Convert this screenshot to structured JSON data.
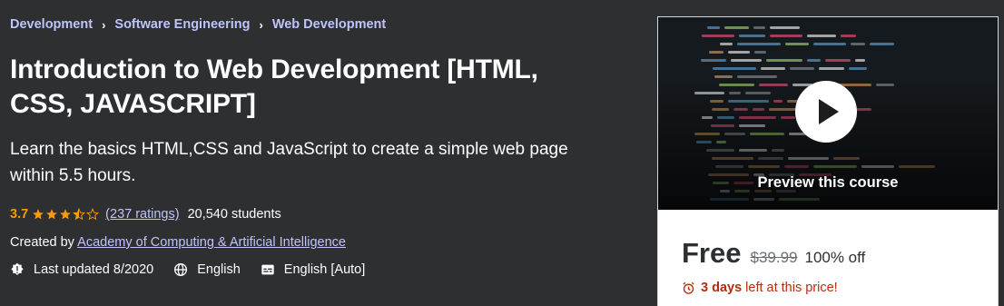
{
  "breadcrumb": {
    "items": [
      "Development",
      "Software Engineering",
      "Web Development"
    ],
    "separator": "›"
  },
  "course": {
    "title": "Introduction to Web Development [HTML, CSS, JAVASCRIPT]",
    "subtitle": "Learn the basics HTML,CSS and JavaScript to create a simple web page within 5.5 hours.",
    "rating": "3.7",
    "rating_value": 3.7,
    "ratings_link": "(237 ratings)",
    "students": "20,540 students",
    "created_prefix": "Created by",
    "instructor": "Academy of Computing & Artificial Intelligence",
    "last_updated": "Last updated 8/2020",
    "language": "English",
    "captions": "English [Auto]"
  },
  "card": {
    "preview_label": "Preview this course",
    "price": "Free",
    "original_price": "$39.99",
    "discount": "100% off",
    "timer_bold": "3 days",
    "timer_rest": "left at this price!"
  },
  "colors": {
    "background": "#2d2f31",
    "link": "#c0c4fc",
    "star": "#f69c08",
    "urgent": "#b32d0f"
  },
  "icons": {
    "updated": "badge-alert-icon",
    "language": "globe-icon",
    "captions": "closed-captions-icon",
    "timer": "alarm-clock-icon",
    "play": "play-icon"
  }
}
